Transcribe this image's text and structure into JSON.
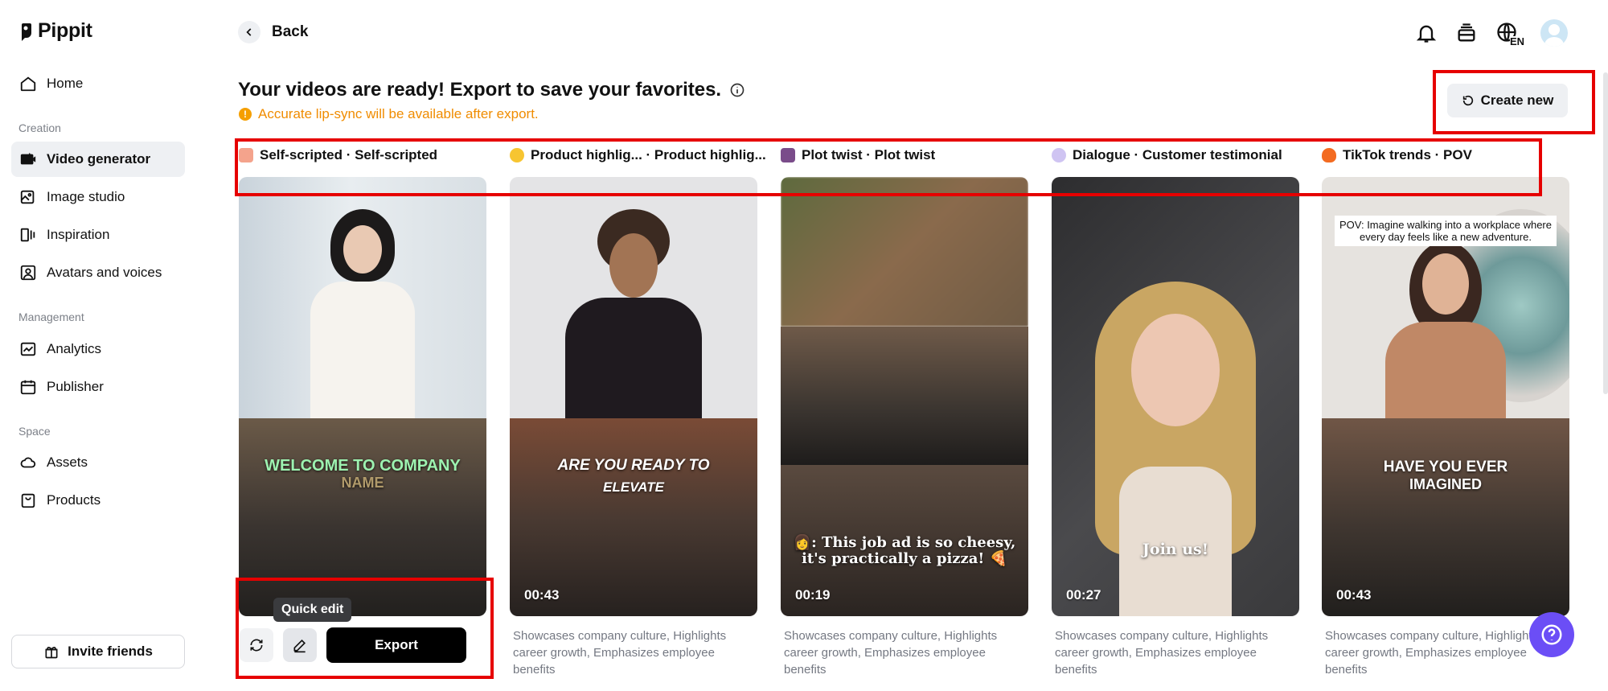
{
  "app": {
    "name": "Pippit"
  },
  "sidebar": {
    "items": [
      {
        "label": "Home",
        "icon": "home-icon"
      },
      {
        "label": "Video generator",
        "icon": "video-generator-icon",
        "active": true
      },
      {
        "label": "Image studio",
        "icon": "image-studio-icon"
      },
      {
        "label": "Inspiration",
        "icon": "inspiration-icon"
      },
      {
        "label": "Avatars and voices",
        "icon": "avatar-icon"
      },
      {
        "label": "Analytics",
        "icon": "analytics-icon"
      },
      {
        "label": "Publisher",
        "icon": "calendar-icon"
      },
      {
        "label": "Assets",
        "icon": "cloud-icon"
      },
      {
        "label": "Products",
        "icon": "bag-icon"
      }
    ],
    "sections": {
      "creation": "Creation",
      "management": "Management",
      "space": "Space"
    },
    "invite_label": "Invite friends"
  },
  "header": {
    "back_label": "Back",
    "title": "Your videos are ready! Export to save your favorites.",
    "warning": "Accurate lip-sync will be available after export.",
    "create_new_label": "Create new",
    "language": "EN"
  },
  "cards": [
    {
      "label": "Self-scripted · Self-scripted",
      "emoji_color": "#f4a38c",
      "caption_1": "WELCOME TO COMPANY",
      "caption_2": "NAME",
      "duration": "",
      "description": ""
    },
    {
      "label": "Product highlig... · Product highlig...",
      "emoji_color": "#f7c531",
      "caption_1": "ARE YOU READY TO",
      "caption_2": "ELEVATE",
      "duration": "00:43",
      "description": "Showcases company culture, Highlights career growth, Emphasizes employee benefits"
    },
    {
      "label": "Plot twist · Plot twist",
      "emoji_color": "#7a4c8a",
      "caption_1": "👩: This job ad is so cheesy,",
      "caption_2": "it's practically a pizza! 🍕",
      "duration": "00:19",
      "description": "Showcases company culture, Highlights career growth, Emphasizes employee benefits"
    },
    {
      "label": "Dialogue · Customer testimonial",
      "emoji_color": "#cfc4f2",
      "caption_1": "Join us!",
      "caption_2": "",
      "duration": "00:27",
      "description": "Showcases company culture, Highlights career growth, Emphasizes employee benefits"
    },
    {
      "label": "TikTok trends · POV",
      "emoji_color": "#f36b21",
      "caption_top": "POV: Imagine walking into a workplace where every day feels like a new adventure.",
      "caption_1": "HAVE YOU EVER",
      "caption_2": "IMAGINED",
      "duration": "00:43",
      "description": "Showcases company culture, Highlights career growth, Emphasizes employee benefits"
    }
  ],
  "actions": {
    "tooltip": "Quick edit",
    "export_label": "Export"
  },
  "colors": {
    "accent_warning": "#f08c00",
    "help_button": "#6b4ef6",
    "annotation": "#e60000"
  }
}
